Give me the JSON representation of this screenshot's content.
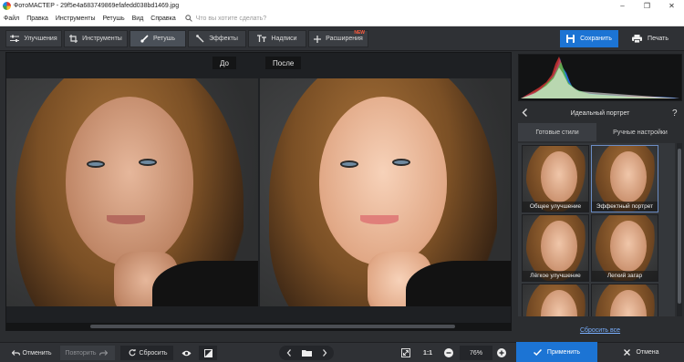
{
  "window": {
    "title": "ФотоМАСТЕР - 29f5e4a683749869efafedd038bd1469.jpg"
  },
  "menu": {
    "items": [
      "Файл",
      "Правка",
      "Инструменты",
      "Ретушь",
      "Вид",
      "Справка"
    ],
    "search_placeholder": "Что вы хотите сделать?"
  },
  "toolbar": {
    "tabs": [
      {
        "label": "Улучшения",
        "icon": "sliders-icon"
      },
      {
        "label": "Инструменты",
        "icon": "crop-icon"
      },
      {
        "label": "Ретушь",
        "icon": "brush-icon",
        "active": true
      },
      {
        "label": "Эффекты",
        "icon": "magic-wand-icon"
      },
      {
        "label": "Надписи",
        "icon": "text-icon"
      },
      {
        "label": "Расширения",
        "icon": "plus-icon",
        "badge": "NEW"
      }
    ],
    "save_label": "Сохранить",
    "print_label": "Печать"
  },
  "canvas": {
    "before_label": "До",
    "after_label": "После"
  },
  "panel": {
    "title": "Идеальный портрет",
    "subtabs": [
      "Готовые стили",
      "Ручные настройки"
    ],
    "styles": [
      "Общее улучшение",
      "Эффектный портрет",
      "Лёгкое улучшение",
      "Легкий загар",
      "",
      ""
    ],
    "reset_all": "Сбросить все"
  },
  "bottom": {
    "undo": "Отменить",
    "redo": "Повторить",
    "reset": "Сбросить",
    "scale_1to1": "1:1",
    "zoom": "76%",
    "apply": "Применить",
    "cancel": "Отмена"
  },
  "colors": {
    "accent": "#1c74d4",
    "link": "#7ab0ff",
    "new_badge": "#ff5a3c"
  }
}
